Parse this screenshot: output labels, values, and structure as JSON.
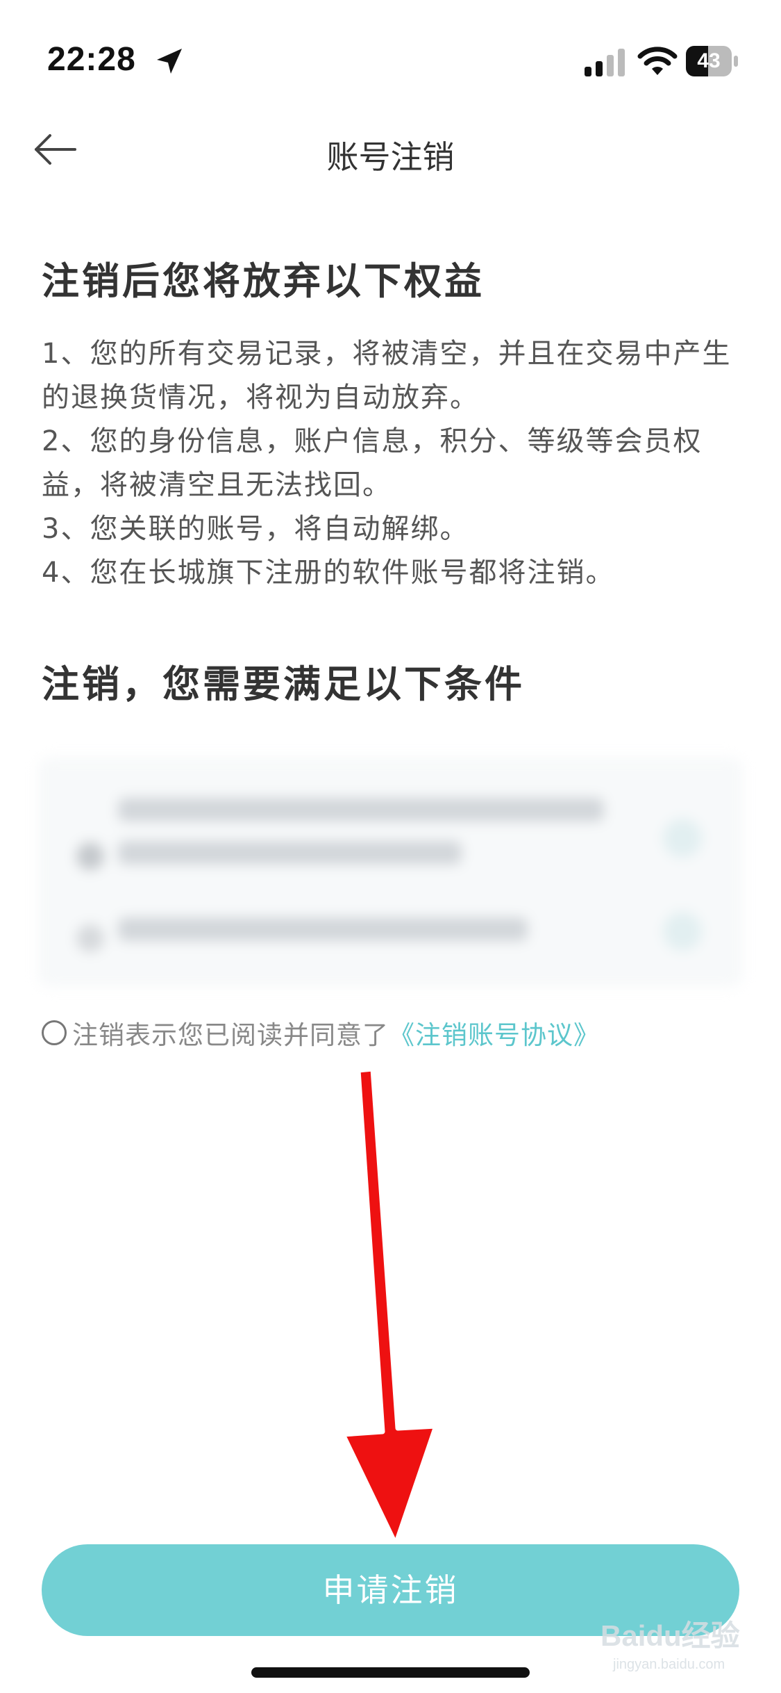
{
  "status_bar": {
    "time": "22:28",
    "battery": "43"
  },
  "nav": {
    "title": "账号注销"
  },
  "rights": {
    "title": "注销后您将放弃以下权益",
    "lines": [
      "1、您的所有交易记录，将被清空，并且在交易中产生",
      "的退换货情况，将视为自动放弃。",
      "2、您的身份信息，账户信息，积分、等级等会员权",
      "益，将被清空且无法找回。",
      "3、您关联的账号，将自动解绑。",
      "4、您在长城旗下注册的软件账号都将注销。"
    ]
  },
  "conditions": {
    "title": "注销，您需要满足以下条件"
  },
  "agreement": {
    "text": "注销表示您已阅读并同意了",
    "link": "《注销账号协议》"
  },
  "apply_button": {
    "label": "申请注销"
  },
  "watermark": {
    "text": "Baidu经验",
    "sub": "jingyan.baidu.com"
  },
  "colors": {
    "accent": "#72d0d4",
    "link": "#5cc6cc",
    "arrow": "#ee1111"
  }
}
